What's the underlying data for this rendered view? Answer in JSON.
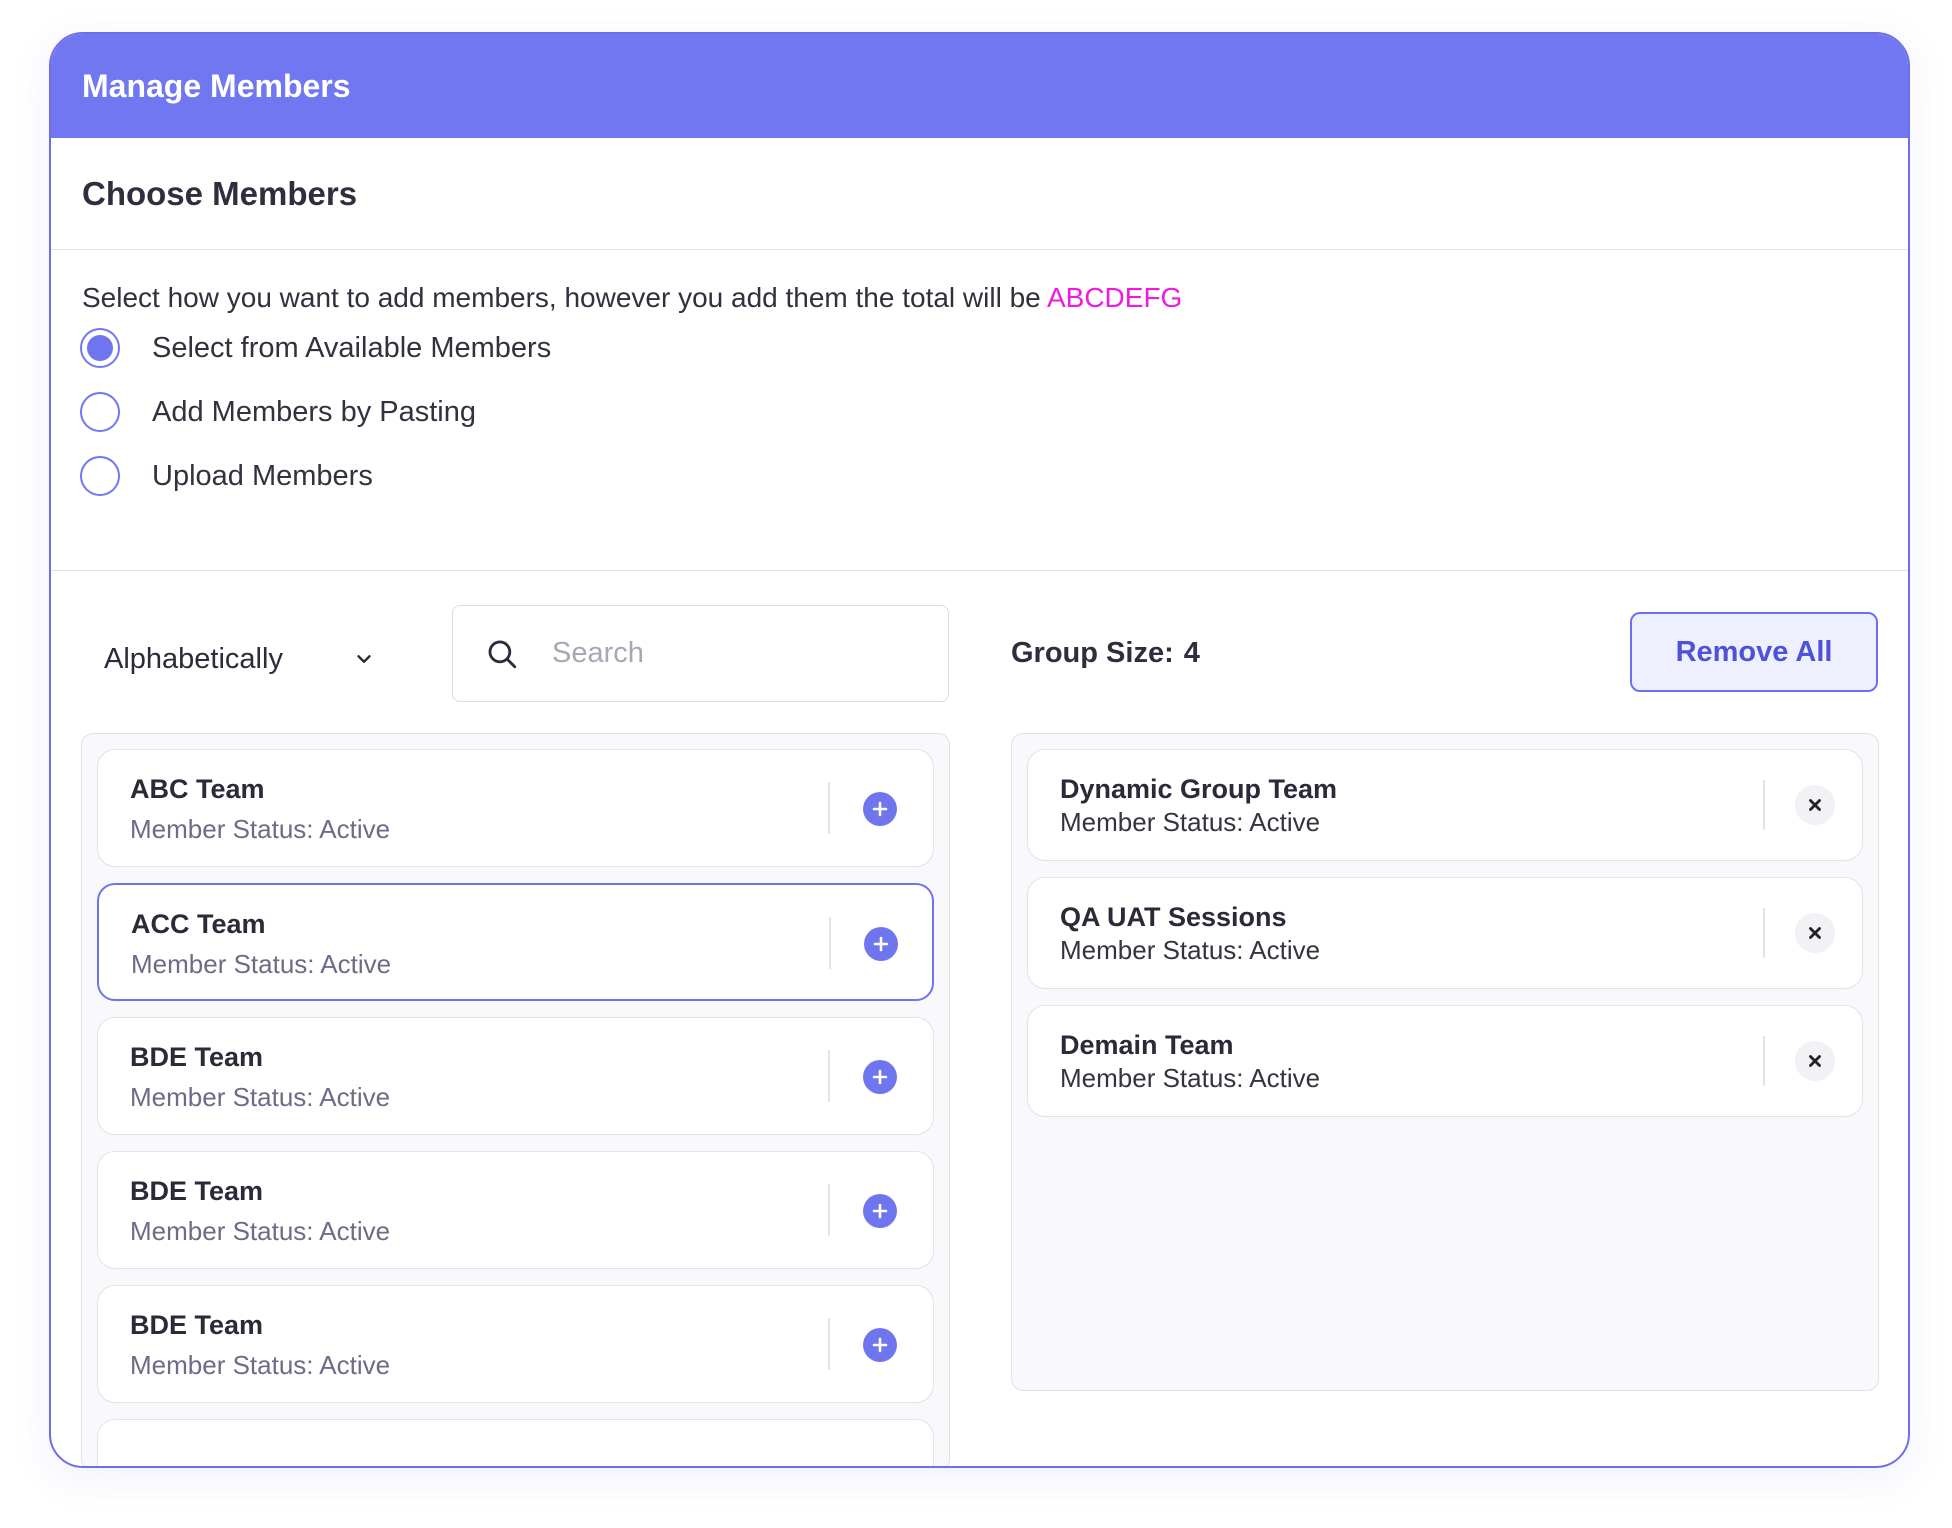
{
  "modal": {
    "title": "Manage Members",
    "section_title": "Choose Members",
    "description": "Select how you want to add members, however you add them the total will be ",
    "description_accent": "ABCDEFG",
    "accent_color": "#f01adf",
    "brand_color": "#7177f0"
  },
  "radio_options": [
    {
      "label": "Select from Available Members",
      "checked": true
    },
    {
      "label": "Add Members by Pasting",
      "checked": false
    },
    {
      "label": "Upload Members",
      "checked": false
    }
  ],
  "toolbar": {
    "sort_label": "Alphabetically",
    "search_placeholder": "Search",
    "group_size_label": "Group Size:",
    "group_size_value": "4",
    "remove_all_label": "Remove All"
  },
  "available_members": [
    {
      "name": "ABC Team",
      "status": "Member Status: Active",
      "selected": false
    },
    {
      "name": "ACC Team",
      "status": "Member Status: Active",
      "selected": true
    },
    {
      "name": "BDE Team",
      "status": "Member Status: Active",
      "selected": false
    },
    {
      "name": "BDE Team",
      "status": "Member Status: Active",
      "selected": false
    },
    {
      "name": "BDE Team",
      "status": "Member Status: Active",
      "selected": false
    }
  ],
  "group_members": [
    {
      "name": "Dynamic Group Team",
      "status": "Member Status: Active"
    },
    {
      "name": "QA UAT Sessions",
      "status": "Member Status: Active"
    },
    {
      "name": "Demain Team",
      "status": "Member Status: Active"
    }
  ]
}
